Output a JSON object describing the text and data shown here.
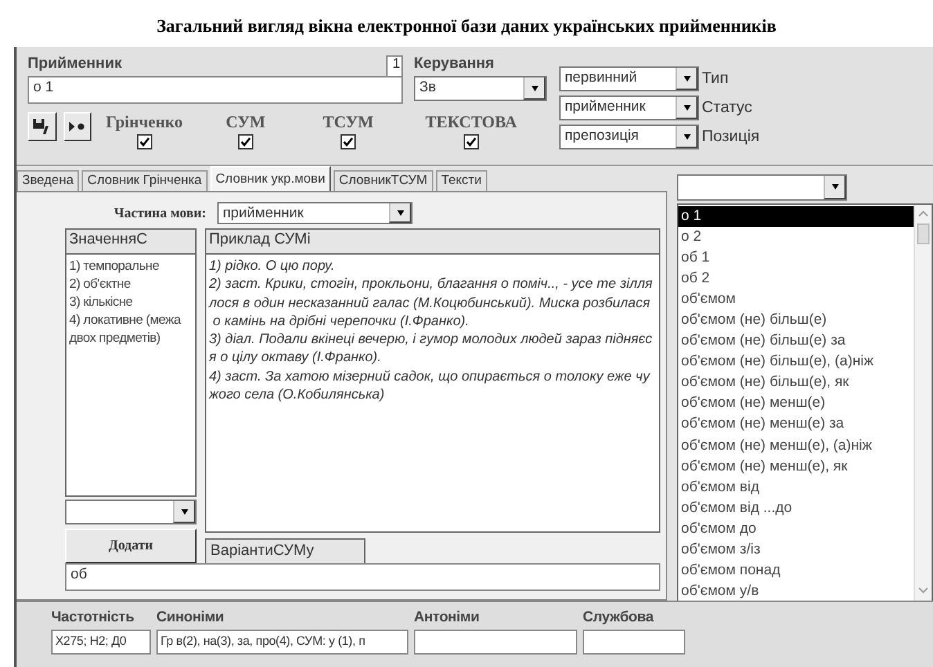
{
  "caption": "Загальний вигляд вікна електронної бази даних українських прийменників",
  "header": {
    "preposition_label": "Прийменник",
    "preposition_value": "о 1",
    "counter": "1",
    "government_label": "Керування",
    "government_value": "Зв"
  },
  "sources": [
    {
      "label": "Грінченко",
      "checked": true
    },
    {
      "label": "СУМ",
      "checked": true
    },
    {
      "label": "ТСУМ",
      "checked": true
    },
    {
      "label": "ТЕКСТОВА",
      "checked": true
    }
  ],
  "properties": [
    {
      "value": "первинний",
      "label": "Тип"
    },
    {
      "value": "прийменник",
      "label": "Статус"
    },
    {
      "value": "препозиція",
      "label": "Позиція"
    }
  ],
  "tabs": [
    {
      "label": "Зведена",
      "selected": false
    },
    {
      "label": "Словник Грінченка",
      "selected": false
    },
    {
      "label": "Словник укр.мови",
      "selected": true
    },
    {
      "label": "СловникТСУМ",
      "selected": false
    },
    {
      "label": "Тексти",
      "selected": false
    }
  ],
  "part_of_speech": {
    "label": "Частина мови:",
    "value": "прийменник"
  },
  "meanings": {
    "heading": "ЗначенняС",
    "items": [
      "1) темпоральне",
      "2) об'єктне",
      "3) кількісне",
      "4) локативне (межа двох предметів)"
    ]
  },
  "examples": {
    "heading": "Приклад СУМі",
    "lines": [
      "1) рідко. О цю пору.",
      "2) заст. Крики, стогін, прокльони, благання о поміч.., - усе те зілля",
      "лося в один несказанний галас (М.Коцюбинський). Миска розбилася",
      " о камінь на дрібні черепочки (І.Франко).",
      "3) діал. Подали вкінеці вечерю, і гумор молодих людей зараз підняєс",
      "я о цілу октаву (І.Франко).",
      "4) заст. За хатою мізерний садок, що опирається о толоку еже чу",
      "жого села (О.Кобилянська)"
    ]
  },
  "add_button": "Додати",
  "variants": {
    "heading": "ВаріантиСУМу",
    "value": "об"
  },
  "list": {
    "items": [
      {
        "label": "о 1",
        "selected": true
      },
      {
        "label": "о 2",
        "selected": false
      },
      {
        "label": "об 1",
        "selected": false
      },
      {
        "label": "об 2",
        "selected": false
      },
      {
        "label": "об'ємом",
        "selected": false
      },
      {
        "label": "об'ємом (не) більш(е)",
        "selected": false
      },
      {
        "label": "об'ємом (не) більш(е) за",
        "selected": false
      },
      {
        "label": "об'ємом (не) більш(е), (а)ніж",
        "selected": false
      },
      {
        "label": "об'ємом (не) більш(е), як",
        "selected": false
      },
      {
        "label": "об'ємом (не) менш(е)",
        "selected": false
      },
      {
        "label": "об'ємом (не) менш(е) за",
        "selected": false
      },
      {
        "label": "об'ємом (не) менш(е), (а)ніж",
        "selected": false
      },
      {
        "label": "об'ємом (не) менш(е), як",
        "selected": false
      },
      {
        "label": "об'ємом від",
        "selected": false
      },
      {
        "label": "об'ємом від ...до",
        "selected": false
      },
      {
        "label": "об'ємом до",
        "selected": false
      },
      {
        "label": "об'ємом з/із",
        "selected": false
      },
      {
        "label": "об'ємом понад",
        "selected": false
      },
      {
        "label": "об'ємом у/в",
        "selected": false
      }
    ]
  },
  "footer": [
    {
      "label": "Частотність",
      "value": "Х275; Н2; Д0"
    },
    {
      "label": "Синоніми",
      "value": "Гр в(2), на(3), за, про(4), СУМ: у (1), п"
    },
    {
      "label": "Антоніми"
    },
    {
      "label": "Службова"
    }
  ]
}
